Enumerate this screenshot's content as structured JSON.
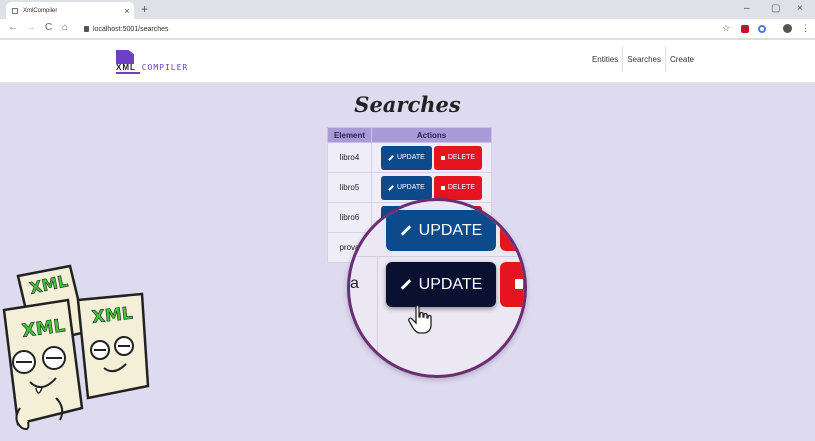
{
  "browser": {
    "tab_title": "XmlCompiler",
    "tab_close": "×",
    "new_tab": "+",
    "url": "localhost:5001/searches",
    "nav_back": "←",
    "nav_forward": "→",
    "nav_reload": "C",
    "nav_home": "⌂",
    "win_minimize": "–",
    "win_restore": "▢",
    "win_close": "×",
    "star_icon": "☆",
    "menu_icon": "⋮"
  },
  "logo": {
    "part1": "XML",
    "part2": " COMPILER"
  },
  "nav": {
    "entities": "Entities",
    "searches": "Searches",
    "create": "Create"
  },
  "page": {
    "title": "Searches"
  },
  "table": {
    "headers": [
      "Element",
      "Actions"
    ],
    "update_label": "UPDATE",
    "delete_label": "DELETE",
    "rows": [
      {
        "element": "libro4"
      },
      {
        "element": "libro5"
      },
      {
        "element": "libro6"
      },
      {
        "element": "prova"
      }
    ]
  },
  "magnifier": {
    "update_label": "UPDATE",
    "row_text": "a"
  },
  "mascots": {
    "label": "XML"
  },
  "colors": {
    "page_bg": "#dedaf0",
    "header_bg": "#a99bd6",
    "update": "#0c4a8c",
    "delete": "#e51420",
    "accent": "#6c3fc5",
    "magnifier_ring": "#6b2d73"
  }
}
